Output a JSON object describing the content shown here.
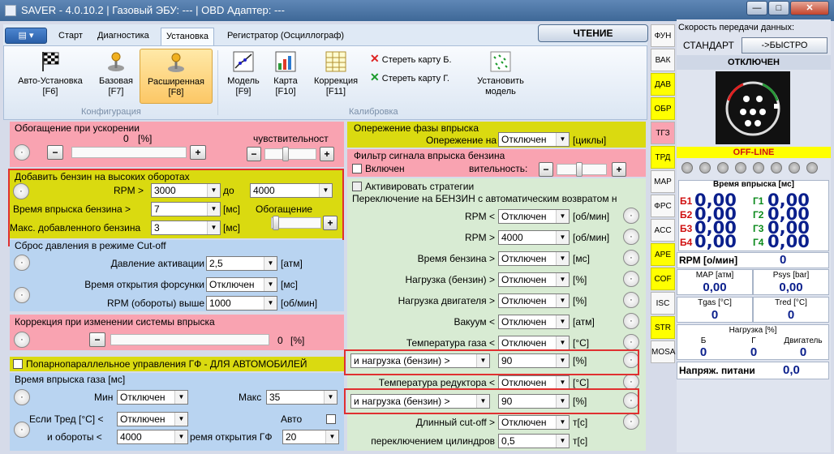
{
  "title": "SAVER - 4.0.10.2  |  Газовый ЭБУ: ---  |  OBD Адаптер: ---",
  "window": {
    "min": "—",
    "max": "□",
    "close": "✕"
  },
  "tabs": [
    "Старт",
    "Диагностика",
    "Установка",
    "Регистратор (Осциллограф)"
  ],
  "read_btn": "ЧТЕНИЕ",
  "ribbon": {
    "auto": "Авто-Установка",
    "auto_k": "[F6]",
    "base": "Базовая",
    "base_k": "[F7]",
    "ext": "Расширенная",
    "ext_k": "[F8]",
    "model": "Модель",
    "model_k": "[F9]",
    "map": "Карта",
    "map_k": "[F10]",
    "corr": "Коррекция",
    "corr_k": "[F11]",
    "erase_b": "Стереть карту Б.",
    "erase_g": "Стереть карту Г.",
    "set": "Установить",
    "set2": "модель",
    "grp_conf": "Конфигурация",
    "grp_cal": "Калибровка"
  },
  "accel": {
    "title": "Обогащение при ускорении",
    "val": "0",
    "unit": "[%]",
    "sens": "чувствительност"
  },
  "highrpm": {
    "title": "Добавить бензин на высоких оборотах",
    "rpm": "RPM >",
    "rpm_v": "3000",
    "to": "до",
    "to_v": "4000",
    "time": "Время впрыска бензина >",
    "time_v": "7",
    "time_u": "[мс]",
    "max": "Макс. добавленного бензина",
    "max_v": "3",
    "max_u": "[мс]",
    "enr": "Обогащение"
  },
  "cutoff": {
    "title": "Сброс давления в режиме Cut-off",
    "act": "Давление активации",
    "act_v": "2,5",
    "act_u": "[атм]",
    "open": "Время открытия форсунки",
    "open_v": "Отключен",
    "open_u": "[мс]",
    "rpm": "RPM (обороты) выше",
    "rpm_v": "1000",
    "rpm_u": "[об/мин]"
  },
  "inj_corr": {
    "title": "Коррекция при изменении системы впрыска",
    "val": "0",
    "unit": "[%]"
  },
  "pair": {
    "label": "Попарнопараллельное управления ГФ - ДЛЯ АВТОМОБИЛЕЙ"
  },
  "gastime": {
    "title": "Время впрыска газа [мс]",
    "min": "Мин",
    "min_v": "Отключен",
    "max": "Макс",
    "max_v": "35",
    "tred": "Если Тред [°C] <",
    "tred_v": "Отключен",
    "auto": "Авто",
    "rpm": "и обороты <",
    "rpm_v": "4000",
    "open": "ремя открытия ГФ",
    "open_v": "20"
  },
  "advance": {
    "title": "Опережение фазы впрыска",
    "label": "Опережение на",
    "val": "Отключен",
    "unit": "[циклы]"
  },
  "filter": {
    "title": "Фильтр сигнала впрыска бензина",
    "on": "Включен",
    "sens": "вительность:"
  },
  "strategy": {
    "label": "Активировать стратегии",
    "title": "Переключение на БЕНЗИН с автоматическим возвратом н",
    "rows": [
      {
        "l": "RPM <",
        "v": "Отключен",
        "u": "[об/мин]"
      },
      {
        "l": "RPM >",
        "v": "4000",
        "u": "[об/мин]"
      },
      {
        "l": "Время бензина >",
        "v": "Отключен",
        "u": "[мс]"
      },
      {
        "l": "Нагрузка (бензин) >",
        "v": "Отключен",
        "u": "[%]"
      },
      {
        "l": "Нагрузка двигателя >",
        "v": "Отключен",
        "u": "[%]"
      },
      {
        "l": "Вакуум <",
        "v": "Отключен",
        "u": "[атм]"
      },
      {
        "l": "Температура газа <",
        "v": "Отключен",
        "u": "[°C]"
      },
      {
        "l": "и нагрузка (бензин) >",
        "v": "90",
        "u": "[%]"
      },
      {
        "l": "Температура редуктора <",
        "v": "Отключен",
        "u": "[°C]"
      },
      {
        "l": "и нагрузка (бензин) >",
        "v": "90",
        "u": "[%]"
      },
      {
        "l": "Длинный cut-off >",
        "v": "Отключен",
        "u": "т[с]"
      },
      {
        "l": "переключением цилиндров",
        "v": "0,5",
        "u": "т[с]"
      }
    ]
  },
  "side": [
    "ФУН",
    "ВАК",
    "ДАВ",
    "ОБР",
    "ТГЗ",
    "ТРД",
    "MAP",
    "ФРС",
    "ACC",
    "APE",
    "COF",
    "ISC",
    "STR",
    "MOSA"
  ],
  "right": {
    "speed": "Скорость передачи данных:",
    "std": "СТАНДАРТ",
    "fast": "->БЫСТРО",
    "off": "ОТКЛЮЧЕН",
    "offline": "OFF-LINE",
    "inj": "Время впрыска [мс]",
    "b": [
      "Б1",
      "Б2",
      "Б3",
      "Б4"
    ],
    "g": [
      "Г1",
      "Г2",
      "Г3",
      "Г4"
    ],
    "bv": [
      "0,00",
      "0,00",
      "0,00",
      "0,00"
    ],
    "gv": [
      "0,00",
      "0,00",
      "0,00",
      "0,00"
    ],
    "rpm": "RPM [о/мин]",
    "rpm_v": "0",
    "map": "MAP [атм]",
    "map_v": "0,00",
    "psys": "Psys [bar]",
    "psys_v": "0,00",
    "tgas": "Tgas [°C]",
    "tgas_v": "0",
    "tred": "Tred [°C]",
    "tred_v": "0",
    "load": "Нагрузка [%]",
    "lb": "Б",
    "lg": "Г",
    "ld": "Двигатель",
    "lb_v": "0",
    "lg_v": "0",
    "ld_v": "0",
    "volt": "Напряж. питани",
    "volt_v": "0,0"
  }
}
